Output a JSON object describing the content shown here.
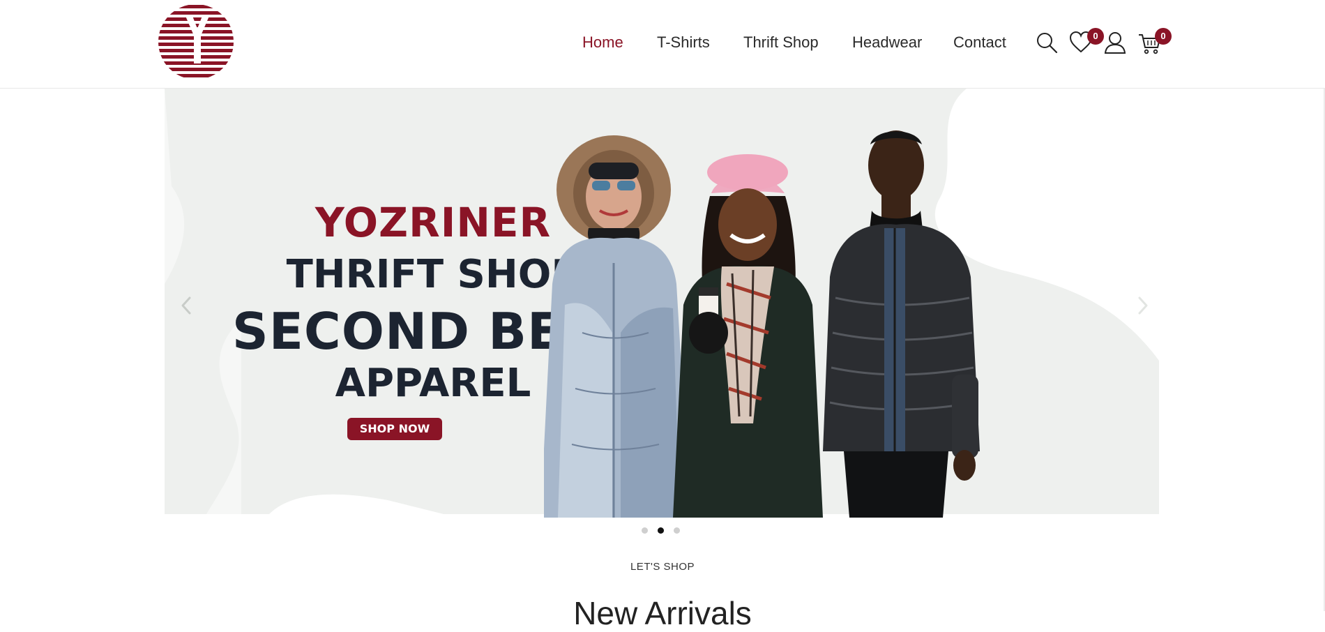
{
  "header": {
    "nav": [
      {
        "label": "Home",
        "active": true
      },
      {
        "label": "T-Shirts",
        "active": false
      },
      {
        "label": "Thrift Shop",
        "active": false
      },
      {
        "label": "Headwear",
        "active": false
      },
      {
        "label": "Contact",
        "active": false
      }
    ],
    "icons": {
      "search": "search-icon",
      "wishlist": "heart-icon",
      "account": "user-icon",
      "cart": "cart-icon"
    },
    "wishlist_count": "0",
    "cart_count": "0",
    "accent_color": "#8a1426"
  },
  "hero": {
    "brand": "YOZRINER",
    "line2": "THRIFT SHOP",
    "line3": "SECOND BEST",
    "line4": "APPAREL",
    "cta": "SHOP NOW",
    "active_slide": 2,
    "slide_count": 3
  },
  "section": {
    "eyebrow": "LET'S SHOP",
    "title": "New Arrivals"
  }
}
